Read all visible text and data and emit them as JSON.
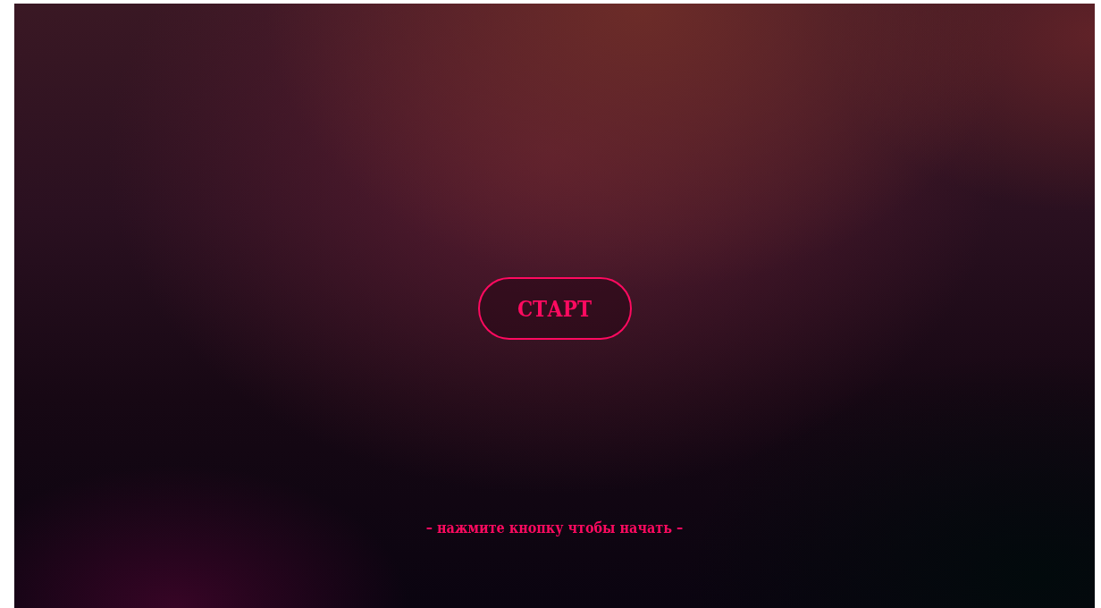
{
  "start_button": {
    "label": "СТАРТ"
  },
  "hint": "– нажмите кнопку чтобы начать –"
}
